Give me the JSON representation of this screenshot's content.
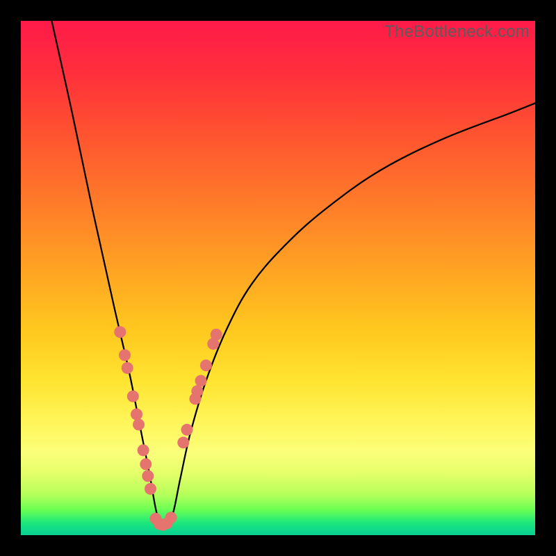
{
  "watermark": "TheBottleneck.com",
  "colors": {
    "background": "#000000",
    "gradient_top": "#ff1a49",
    "gradient_mid": "#ffe431",
    "gradient_bottom": "#0ad08f",
    "curve": "#000000",
    "dots": "#e5746e"
  },
  "chart_data": {
    "type": "line",
    "title": "",
    "xlabel": "",
    "ylabel": "",
    "xlim": [
      0,
      100
    ],
    "ylim": [
      0,
      100
    ],
    "notes": "V-shaped bottleneck curve on a vertical heat gradient. Minimum of curve sits near x≈27. Coral dots mark sampled points along the lower segment of the curve (left and right arms near the trough). x and y are in percent of plot area; y=0 is bottom.",
    "curve_min_x": 27,
    "series": [
      {
        "name": "bottleneck-curve",
        "x": [
          6,
          10,
          14,
          18,
          21,
          23,
          25,
          26.5,
          28,
          29.5,
          31,
          33,
          36,
          40,
          45,
          52,
          60,
          70,
          82,
          95,
          100
        ],
        "y": [
          100,
          82,
          63,
          45,
          32,
          22,
          12,
          4,
          2,
          4,
          11,
          20,
          30,
          40,
          49,
          57,
          64,
          71,
          77,
          82,
          84
        ]
      },
      {
        "name": "sample-dots-left-arm",
        "x": [
          19.3,
          20.2,
          20.7,
          21.8,
          22.5,
          22.9,
          23.8,
          24.3,
          24.7,
          25.2
        ],
        "y": [
          39.5,
          35.0,
          32.5,
          27.0,
          23.5,
          21.5,
          16.5,
          13.8,
          11.5,
          9.0
        ]
      },
      {
        "name": "sample-dots-trough",
        "x": [
          26.2,
          26.9,
          27.6,
          28.4,
          29.2
        ],
        "y": [
          3.2,
          2.2,
          2.0,
          2.3,
          3.4
        ]
      },
      {
        "name": "sample-dots-right-arm",
        "x": [
          31.6,
          32.3,
          33.9,
          34.3,
          35.0,
          36.0,
          37.4,
          38.0
        ],
        "y": [
          18.0,
          20.5,
          26.5,
          28.0,
          30.0,
          33.0,
          37.2,
          39.0
        ]
      }
    ]
  }
}
